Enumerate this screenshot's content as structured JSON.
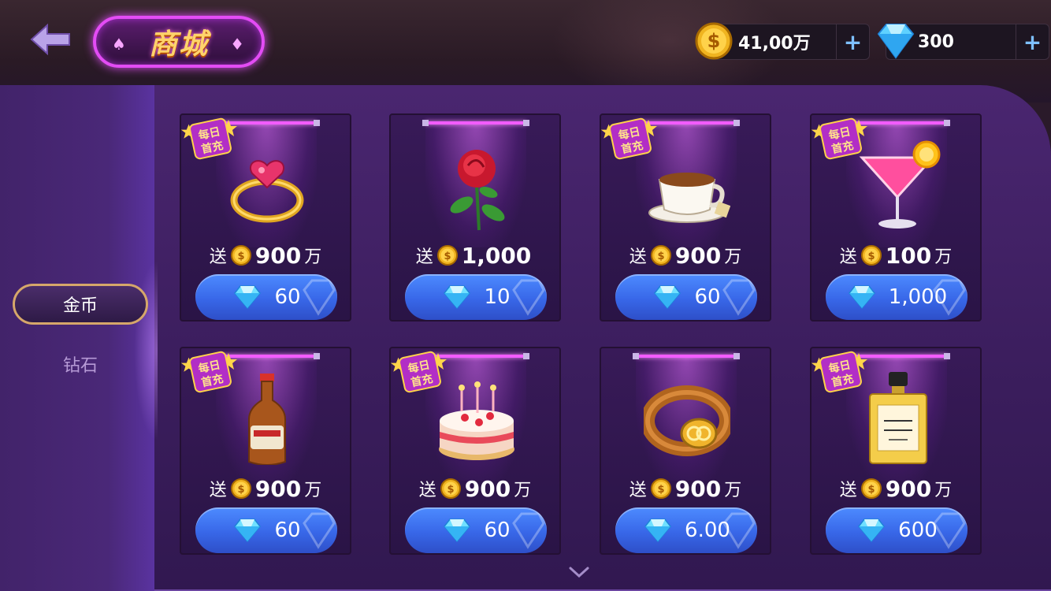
{
  "header": {
    "title": "商城",
    "coins": {
      "amount": "41,00万",
      "plus": "+"
    },
    "diamonds": {
      "amount": "300",
      "plus": "+"
    }
  },
  "sidebar": {
    "tabs": [
      {
        "label": "金币",
        "active": true
      },
      {
        "label": "钻石",
        "active": false
      }
    ]
  },
  "badge_text": "每日首充",
  "items": [
    {
      "icon": "ring-icon",
      "daily_badge": true,
      "bonus_prefix": "送",
      "bonus_value": "900",
      "bonus_unit": "万",
      "price": "60"
    },
    {
      "icon": "rose-icon",
      "daily_badge": false,
      "bonus_prefix": "送",
      "bonus_value": "1,000",
      "bonus_unit": "",
      "price": "10"
    },
    {
      "icon": "coffee-cup-icon",
      "daily_badge": true,
      "bonus_prefix": "送",
      "bonus_value": "900",
      "bonus_unit": "万",
      "price": "60"
    },
    {
      "icon": "cocktail-icon",
      "daily_badge": true,
      "bonus_prefix": "送",
      "bonus_value": "100",
      "bonus_unit": "万",
      "price": "1,000"
    },
    {
      "icon": "beer-bottle-icon",
      "daily_badge": true,
      "bonus_prefix": "送",
      "bonus_value": "900",
      "bonus_unit": "万",
      "price": "60"
    },
    {
      "icon": "cake-icon",
      "daily_badge": true,
      "bonus_prefix": "送",
      "bonus_value": "900",
      "bonus_unit": "万",
      "price": "60"
    },
    {
      "icon": "belt-icon",
      "daily_badge": false,
      "bonus_prefix": "送",
      "bonus_value": "900",
      "bonus_unit": "万",
      "price": "6.00"
    },
    {
      "icon": "perfume-icon",
      "daily_badge": true,
      "bonus_prefix": "送",
      "bonus_value": "900",
      "bonus_unit": "万",
      "price": "600"
    }
  ],
  "colors": {
    "accent_pink": "#e34cf5",
    "price_blue": "#3867e8",
    "gold": "#ffd36b",
    "panel_purple": "#3a1d5c"
  }
}
